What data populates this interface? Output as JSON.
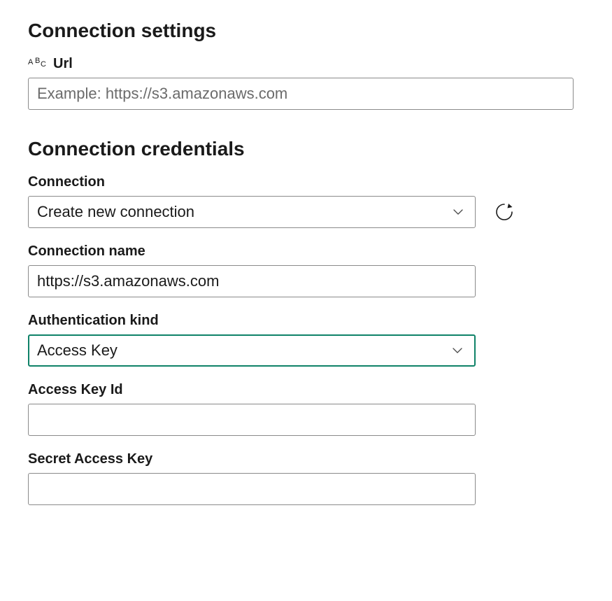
{
  "settings": {
    "title": "Connection settings",
    "url_label": "Url",
    "url_placeholder": "Example: https://s3.amazonaws.com",
    "url_value": ""
  },
  "credentials": {
    "title": "Connection credentials",
    "connection_label": "Connection",
    "connection_value": "Create new connection",
    "connection_name_label": "Connection name",
    "connection_name_value": "https://s3.amazonaws.com",
    "auth_kind_label": "Authentication kind",
    "auth_kind_value": "Access Key",
    "access_key_id_label": "Access Key Id",
    "access_key_id_value": "",
    "secret_key_label": "Secret Access Key",
    "secret_key_value": ""
  },
  "icons": {
    "text_column": "abc-icon",
    "chevron_down": "chevron-down-icon",
    "refresh": "refresh-icon"
  },
  "colors": {
    "accent": "#0f8268",
    "border": "#8a8a8a",
    "placeholder": "#6b6b6b"
  }
}
